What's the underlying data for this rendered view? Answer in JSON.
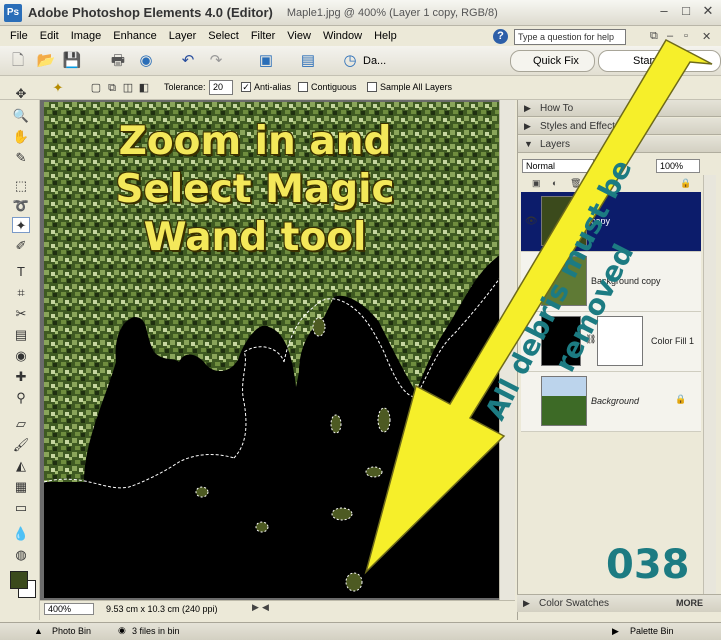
{
  "window": {
    "app_title": "Adobe Photoshop Elements 4.0 (Editor)",
    "doc_title": "Maple1.jpg @ 400% (Layer 1 copy, RGB/8)",
    "controls": [
      "–",
      "□",
      "✕"
    ]
  },
  "menubar": {
    "items": [
      "File",
      "Edit",
      "Image",
      "Enhance",
      "Layer",
      "Select",
      "Filter",
      "View",
      "Window",
      "Help"
    ],
    "help_placeholder": "Type a question for help"
  },
  "shortcuts": {
    "date_view_label": "Da...",
    "quick_fix_label": "Quick Fix",
    "standard_edit_label": "Standa"
  },
  "options": {
    "tolerance_label": "Tolerance:",
    "tolerance_value": "20",
    "anti_alias_label": "Anti-alias",
    "anti_alias_checked": true,
    "contiguous_label": "Contiguous",
    "contiguous_checked": false,
    "sample_all_label": "Sample All Layers",
    "sample_all_checked": false
  },
  "status": {
    "zoom": "400%",
    "doc_size": "9.53 cm x 10.3 cm (240 ppi)"
  },
  "palette": {
    "how_to": "How To",
    "styles_effects": "Styles and Effects",
    "layers": "Layers",
    "blend_mode": "Normal",
    "opacity": "100%",
    "layer_items": [
      {
        "name": "copy",
        "selected": true
      },
      {
        "name": "Background copy",
        "selected": false
      },
      {
        "name": "Color Fill 1",
        "selected": false
      },
      {
        "name": "Background",
        "selected": false
      }
    ],
    "color_swatches": "Color Swatches",
    "more_label": "MORE"
  },
  "bottombar": {
    "photo_bin": "Photo Bin",
    "files_in_bin": "3 files in bin",
    "palette_bin": "Palette Bin"
  },
  "overlay": {
    "instruction_line1": "Zoom in and",
    "instruction_line2": "Select Magic",
    "instruction_line3": "Wand tool",
    "arrow_text": "All debris must be removed",
    "lesson_number": "038"
  },
  "colors": {
    "foreground": "#3b4a1c",
    "background": "#ffffff",
    "overlay_yellow": "#f4e85a",
    "overlay_teal": "#1c7b82",
    "selected_layer": "#0c1c6b"
  }
}
